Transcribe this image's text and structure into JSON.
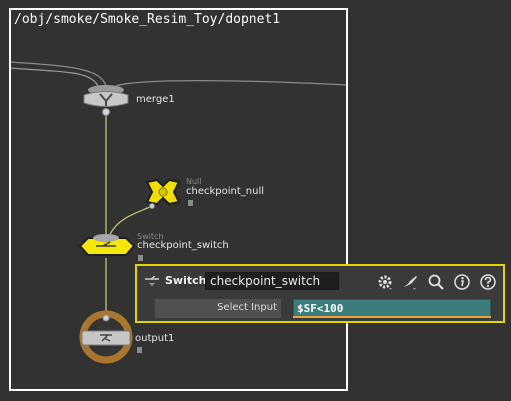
{
  "network": {
    "path": "/obj/smoke/Smoke_Resim_Toy/dopnet1"
  },
  "nodes": {
    "merge": {
      "label": "merge1"
    },
    "null": {
      "type": "Null",
      "label": "checkpoint_null"
    },
    "switch": {
      "type": "Switch",
      "label": "checkpoint_switch"
    },
    "output": {
      "label": "output1"
    }
  },
  "panel": {
    "type_name": "Switch",
    "node_name": "checkpoint_switch",
    "param_label": "Select Input",
    "param_value": "$SF<100",
    "toolbar_icons": [
      "gear-icon",
      "brush-icon",
      "magnifier-icon",
      "info-icon",
      "help-icon"
    ]
  },
  "colors": {
    "background": "#323232",
    "selection": "#e4d100",
    "expression": "#3b7c7c",
    "output_ring": "#b07a30"
  }
}
